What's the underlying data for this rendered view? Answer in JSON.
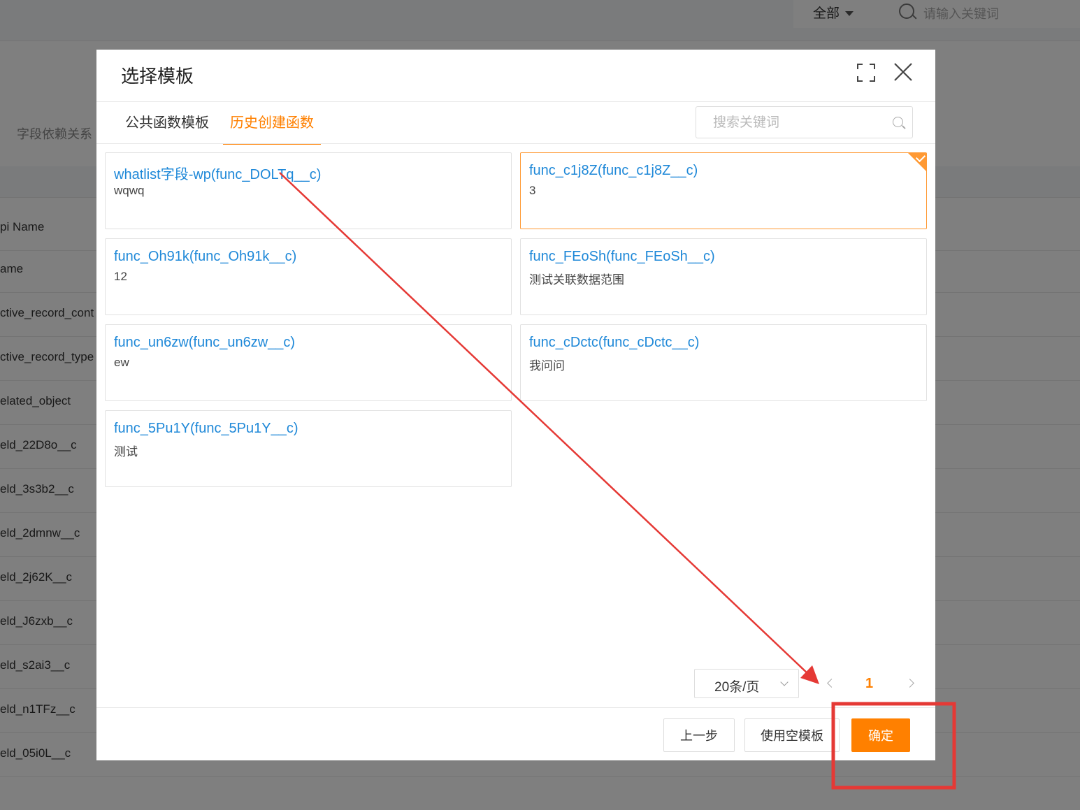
{
  "background": {
    "scope_select": "全部",
    "search_placeholder": "请输入关键词",
    "dependency_label": "字段依赖关系",
    "rows": [
      "pi Name",
      "ame",
      "ctive_record_cont",
      "ctive_record_type",
      "elated_object",
      "eld_22D8o__c",
      "eld_3s3b2__c",
      "eld_2dmnw__c",
      "eld_2j62K__c",
      "eld_J6zxb__c",
      "eld_s2ai3__c",
      "eld_n1TFz__c",
      "eld_05i0L__c"
    ]
  },
  "dialog": {
    "title": "选择模板",
    "tabs": [
      {
        "label": "公共函数模板",
        "active": false
      },
      {
        "label": "历史创建函数",
        "active": true
      }
    ],
    "search_placeholder": "搜索关键词",
    "cards": [
      {
        "title": "whatlist字段-wp(func_DOLTq__c)",
        "desc": "wqwq",
        "selected": false
      },
      {
        "title": "func_c1j8Z(func_c1j8Z__c)",
        "desc": "3",
        "selected": true
      },
      {
        "title": "func_Oh91k(func_Oh91k__c)",
        "desc": "12",
        "selected": false
      },
      {
        "title": "func_FEoSh(func_FEoSh__c)",
        "desc": "测试关联数据范围",
        "selected": false
      },
      {
        "title": "func_un6zw(func_un6zw__c)",
        "desc": "ew",
        "selected": false
      },
      {
        "title": "func_cDctc(func_cDctc__c)",
        "desc": "我问问",
        "selected": false
      },
      {
        "title": "func_5Pu1Y(func_5Pu1Y__c)",
        "desc": "测试",
        "selected": false
      }
    ],
    "pagination": {
      "page_size": "20条/页",
      "current_page": "1"
    },
    "footer": {
      "prev_label": "上一步",
      "empty_template_label": "使用空模板",
      "confirm_label": "确定"
    }
  },
  "colors": {
    "accent": "#ff8000",
    "link": "#1e88d8",
    "annotation": "#e53935"
  }
}
